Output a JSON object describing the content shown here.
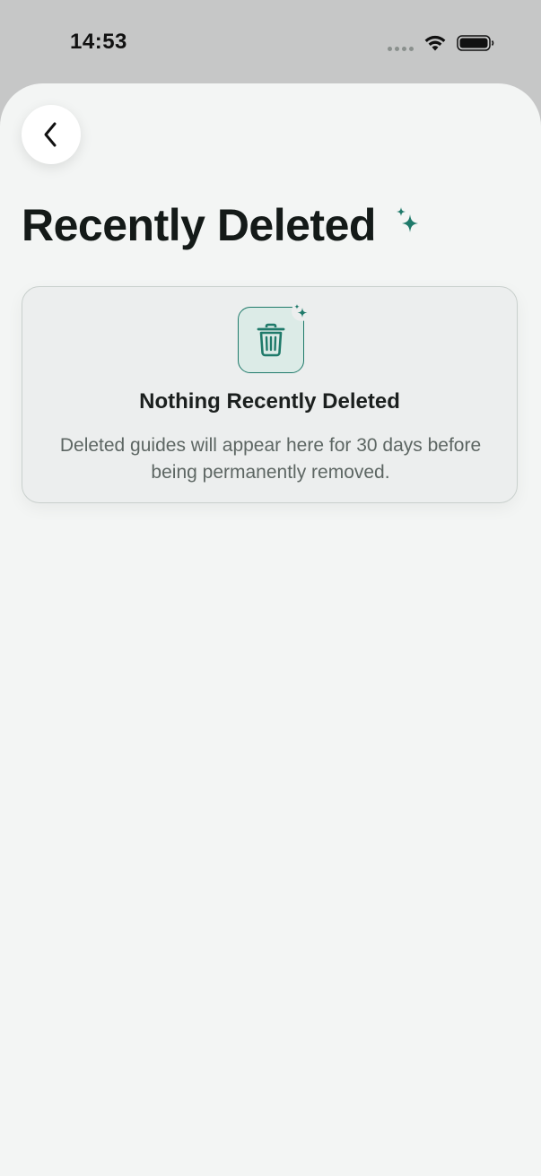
{
  "status_bar": {
    "time": "14:53",
    "icons": [
      "cellular-dots-icon",
      "wifi-icon",
      "battery-icon"
    ]
  },
  "header": {
    "back_icon": "chevron-left-icon",
    "title": "Recently Deleted",
    "title_icon": "sparkles-icon"
  },
  "empty_state": {
    "icon": "trash-icon",
    "badge_icon": "sparkles-icon",
    "title": "Nothing Recently Deleted",
    "description": "Deleted guides will appear here for 30 days before being permanently removed."
  },
  "colors": {
    "accent": "#1f7a6a",
    "background": "#f3f5f4",
    "status_bar": "#c6c7c7",
    "title_text": "#141a18",
    "secondary_text": "#5d6663"
  }
}
